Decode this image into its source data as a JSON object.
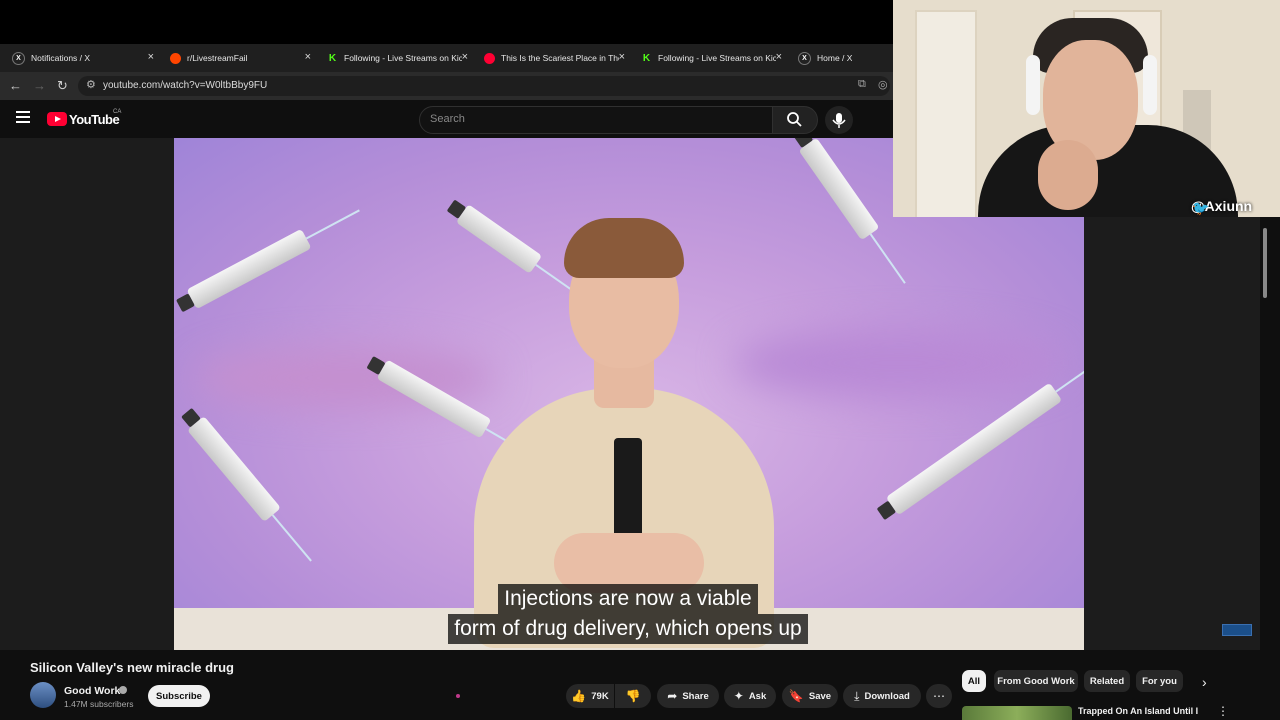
{
  "browser": {
    "tabs": [
      {
        "title": "Notifications / X",
        "favicon": "x-logo-icon"
      },
      {
        "title": "r/LivestreamFail",
        "favicon": "reddit-icon"
      },
      {
        "title": "Following - Live Streams on Kic",
        "favicon": "kick-icon"
      },
      {
        "title": "This Is the Scariest Place in The",
        "favicon": "youtube-icon"
      },
      {
        "title": "Following - Live Streams on Kic",
        "favicon": "kick-icon"
      },
      {
        "title": "Home / X",
        "favicon": "x-logo-icon"
      }
    ],
    "close_glyph": "×",
    "url": "youtube.com/watch?v=W0ltbBby9FU"
  },
  "youtube": {
    "logo_text": "YouTube",
    "region": "CA",
    "search_placeholder": "Search",
    "video": {
      "subtitle_line1": "Injections are now a viable",
      "subtitle_line2": "form of drug delivery, which opens up"
    },
    "title": "Silicon Valley's new miracle drug",
    "channel": {
      "name": "Good Work",
      "subscribers": "1.47M subscribers",
      "subscribe_label": "Subscribe"
    },
    "actions": {
      "likes": "79K",
      "share": "Share",
      "ask": "Ask",
      "save": "Save",
      "download": "Download"
    },
    "chips": [
      "All",
      "From Good Work",
      "Related",
      "For you"
    ],
    "recommendation": {
      "title": "Trapped On An Island Until I"
    }
  },
  "webcam": {
    "handle": "@Axiunn"
  },
  "colors": {
    "youtube_red": "#ff0033",
    "kick_green": "#53fc18",
    "twitter_blue": "#1da1f2",
    "background": "#0f0f0f"
  }
}
